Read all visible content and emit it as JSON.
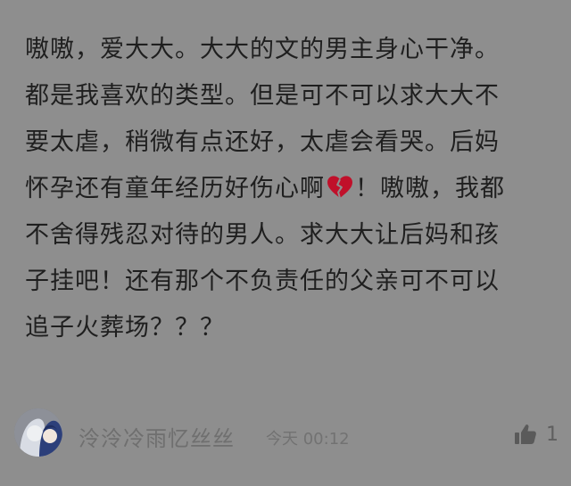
{
  "comment": {
    "lines": [
      "嗷嗷，爱大大。大大的文的男主身心干净。",
      "都是我喜欢的类型。但是可不可以求大大不",
      "要太虐，稍微有点还好，太虐会看哭。后妈",
      "怀孕还有童年经历好伤心啊",
      "！嗷嗷，我都",
      "不舍得残忍对待的男人。求大大让后妈和孩",
      "子挂吧！还有那个不负责任的父亲可不可以",
      "追子火葬场？？？"
    ],
    "emoji": "broken-heart-icon"
  },
  "footer": {
    "username": "泠泠冷雨忆丝丝",
    "timestamp": "今天 00:12",
    "like_count": "1",
    "like_icon": "thumbs-up-icon",
    "avatar_icon": "avatar-anime-icon"
  },
  "colors": {
    "background": "#8e8e8e",
    "text": "#1f1f1f",
    "meta": "#6f6f6f",
    "heart": "#c0102a"
  }
}
